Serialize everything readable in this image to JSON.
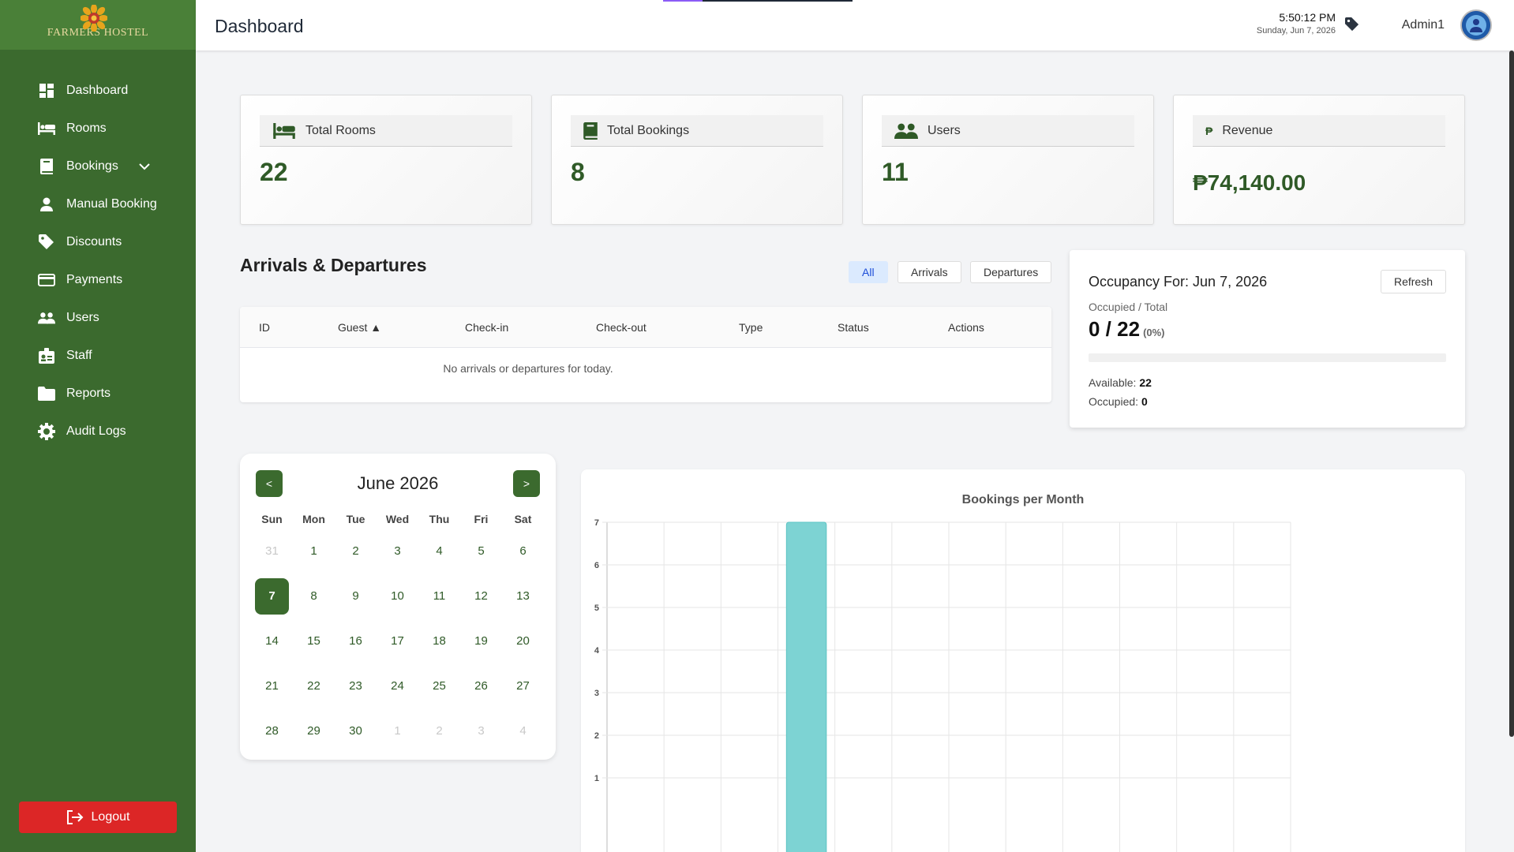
{
  "brand": {
    "name": "FARMERS HOSTEL"
  },
  "sidebar": {
    "items": [
      {
        "label": "Dashboard",
        "icon": "dashboard-icon"
      },
      {
        "label": "Rooms",
        "icon": "bed-icon"
      },
      {
        "label": "Bookings",
        "icon": "book-icon"
      },
      {
        "label": "Manual Booking",
        "icon": "user-icon"
      },
      {
        "label": "Discounts",
        "icon": "tag-icon"
      },
      {
        "label": "Payments",
        "icon": "credit-card-icon"
      },
      {
        "label": "Users",
        "icon": "users-icon"
      },
      {
        "label": "Staff",
        "icon": "id-card-icon"
      },
      {
        "label": "Reports",
        "icon": "folder-icon"
      },
      {
        "label": "Audit Logs",
        "icon": "gear-icon"
      }
    ],
    "logout_label": "Logout"
  },
  "header": {
    "title": "Dashboard",
    "time": "5:50:12 PM",
    "date": "Sunday, Jun 7, 2026",
    "user": "Admin1"
  },
  "stats": [
    {
      "label": "Total Rooms",
      "value": "22",
      "icon": "bed-icon"
    },
    {
      "label": "Total Bookings",
      "value": "8",
      "icon": "book-icon"
    },
    {
      "label": "Users",
      "value": "11",
      "icon": "users-icon"
    },
    {
      "label": "Revenue",
      "value": "₱74,140.00",
      "icon": "peso-icon"
    }
  ],
  "arrivals": {
    "title": "Arrivals & Departures",
    "filters": [
      "All",
      "Arrivals",
      "Departures"
    ],
    "active_filter": "All",
    "columns": [
      "ID",
      "Guest ▲",
      "Check-in",
      "Check-out",
      "Type",
      "Status",
      "Actions"
    ],
    "empty_message": "No arrivals or departures for today."
  },
  "occupancy": {
    "title": "Occupancy For: Jun 7, 2026",
    "refresh_label": "Refresh",
    "label": "Occupied / Total",
    "ratio": "0 / 22",
    "percent_text": "(0%)",
    "percent": 0,
    "available_label": "Available:",
    "available": "22",
    "occupied_label": "Occupied:",
    "occupied": "0"
  },
  "calendar": {
    "month": "June 2026",
    "prev": "<",
    "next": ">",
    "dow": [
      "Sun",
      "Mon",
      "Tue",
      "Wed",
      "Thu",
      "Fri",
      "Sat"
    ],
    "days": [
      {
        "d": "31",
        "m": true
      },
      {
        "d": "1"
      },
      {
        "d": "2"
      },
      {
        "d": "3"
      },
      {
        "d": "4"
      },
      {
        "d": "5"
      },
      {
        "d": "6"
      },
      {
        "d": "7",
        "t": true
      },
      {
        "d": "8"
      },
      {
        "d": "9"
      },
      {
        "d": "10"
      },
      {
        "d": "11"
      },
      {
        "d": "12"
      },
      {
        "d": "13"
      },
      {
        "d": "14"
      },
      {
        "d": "15"
      },
      {
        "d": "16"
      },
      {
        "d": "17"
      },
      {
        "d": "18"
      },
      {
        "d": "19"
      },
      {
        "d": "20"
      },
      {
        "d": "21"
      },
      {
        "d": "22"
      },
      {
        "d": "23"
      },
      {
        "d": "24"
      },
      {
        "d": "25"
      },
      {
        "d": "26"
      },
      {
        "d": "27"
      },
      {
        "d": "28"
      },
      {
        "d": "29"
      },
      {
        "d": "30"
      },
      {
        "d": "1",
        "m": true
      },
      {
        "d": "2",
        "m": true
      },
      {
        "d": "3",
        "m": true
      },
      {
        "d": "4",
        "m": true
      }
    ]
  },
  "chart_data": {
    "type": "bar",
    "title": "Bookings per Month",
    "categories": [
      "",
      "",
      "",
      "",
      "",
      "",
      "",
      "",
      "",
      "",
      "",
      ""
    ],
    "values": [
      0,
      0,
      0,
      7,
      0,
      0,
      0,
      0,
      0,
      0,
      0,
      0
    ],
    "yticks": [
      1,
      2,
      3,
      4,
      5,
      6,
      7
    ],
    "ylim": [
      0,
      7
    ],
    "grid": true,
    "bar_color": "#7dd3d3"
  },
  "colors": {
    "sidebar": "#3b6a2e",
    "accent": "#2f5a27",
    "danger": "#dc2626"
  }
}
